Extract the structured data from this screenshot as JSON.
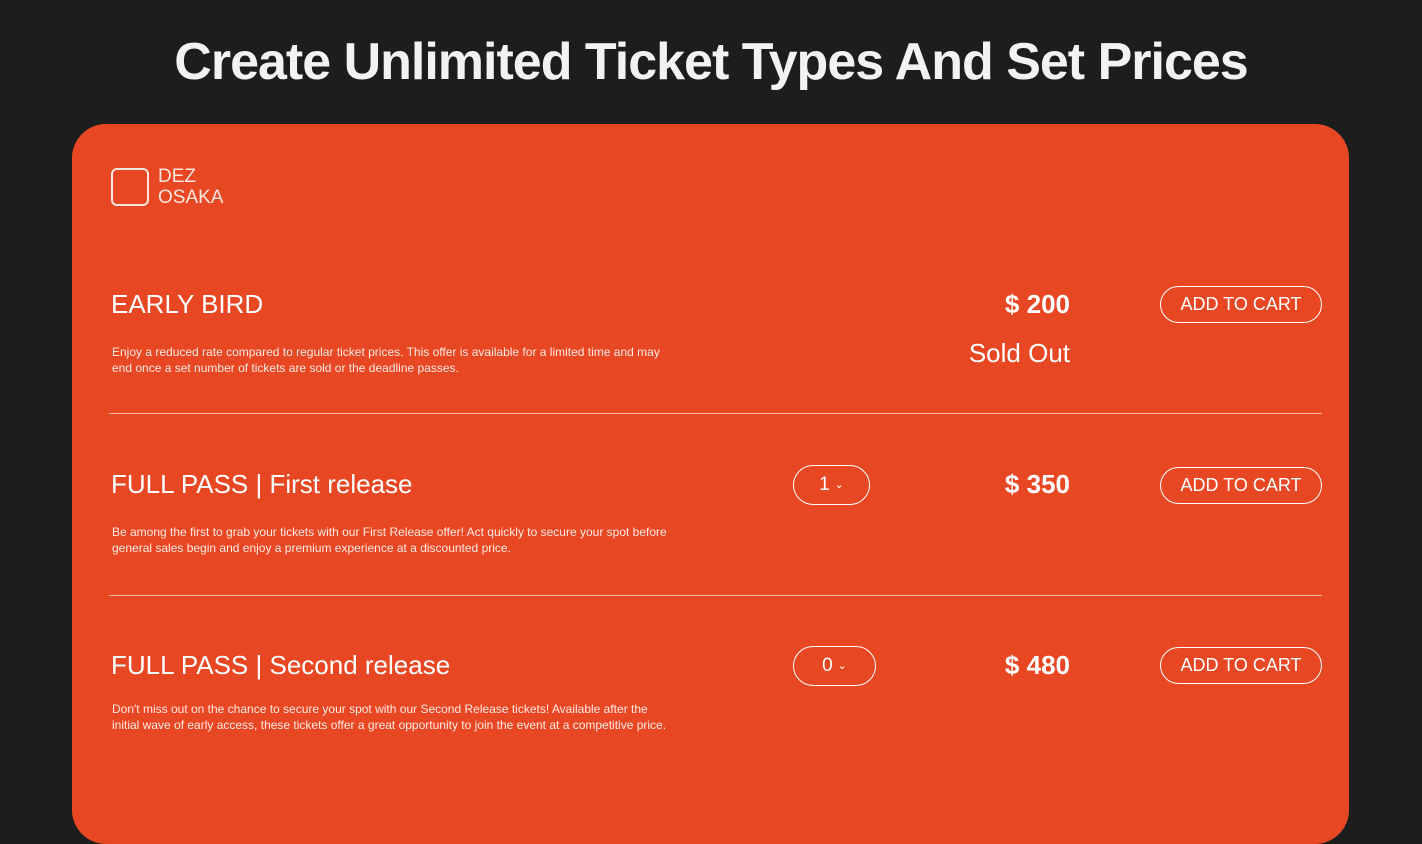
{
  "headline": "Create Unlimited Ticket Types And Set Prices",
  "logo": {
    "line1": "DEZ",
    "line2": "OSAKA"
  },
  "tickets": [
    {
      "title": "EARLY BIRD",
      "description": "Enjoy a reduced rate compared to regular ticket prices. This offer is available for a limited time and may end once a set number of tickets are sold or the deadline passes.",
      "price": "$ 200",
      "status": "Sold Out",
      "cart_label": "ADD TO CART"
    },
    {
      "title": "FULL PASS | First release",
      "description": "Be among the first to grab your tickets with our First Release offer!  Act quickly to secure your spot before general sales begin and enjoy a premium experience at a discounted price.",
      "price": "$ 350",
      "quantity": "1",
      "cart_label": "ADD TO CART"
    },
    {
      "title": "FULL PASS | Second release",
      "description": "Don't miss out on the chance to secure your spot with our Second Release tickets! Available after the initial wave of early access, these tickets offer a great opportunity to join the event at a competitive price.",
      "price": "$ 480",
      "quantity": "0",
      "cart_label": "ADD TO CART"
    }
  ],
  "icons": {
    "quantity_dropdown": "chevron-down-icon",
    "logo_mark": "square-outline-icon"
  },
  "colors": {
    "background": "#1d1d1d",
    "card": "#e84723",
    "text": "#ffffff"
  }
}
